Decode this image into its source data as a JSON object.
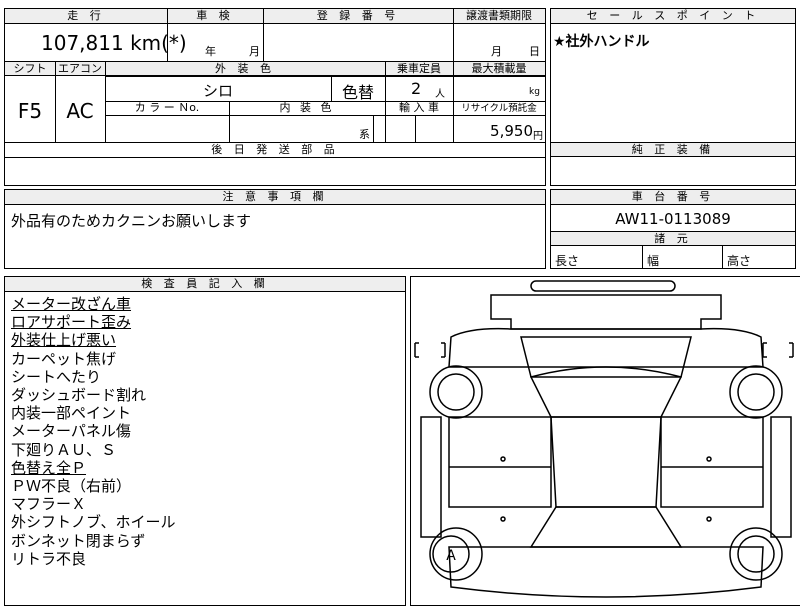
{
  "main_table": {
    "h_mileage": "走 行",
    "h_inspection": "車 検",
    "h_registration": "登 録 番 号",
    "h_transfer_deadline": "譲渡書類期限",
    "mileage": "107,811 km(*)",
    "inspection_year_label": "年",
    "inspection_month_label": "月",
    "transfer_month_label": "月",
    "transfer_day_label": "日",
    "h_shift": "シフト",
    "h_aircon": "エアコン",
    "h_exterior_color": "外 装 色",
    "h_capacity": "乗車定員",
    "h_max_load": "最大積載量",
    "shift": "F5",
    "aircon": "AC",
    "exterior_color": "シロ",
    "color_change": "色替",
    "capacity": "2",
    "capacity_unit": "人",
    "max_load_unit": "kg",
    "h_color_no": "カ ラ ー Ｎo.",
    "h_interior_color": "内 装 色",
    "h_import": "輸 入 車",
    "h_recycle": "リサイクル預託金",
    "interior_color_unit": "系",
    "recycle_fee": "5,950",
    "recycle_unit": "円",
    "h_later_parts": "後 日 発 送 部 品"
  },
  "sales_points": {
    "header": "セ ー ル ス ポ イ ン ト",
    "text": "★社外ハンドル",
    "genuine_header": "純 正 装 備"
  },
  "notes": {
    "header": "注 意 事 項 欄",
    "text": "外品有のためカクニンお願いします"
  },
  "chassis": {
    "header": "車 台 番 号",
    "number": "AW11-0113089",
    "spec_header": "諸 元",
    "length_label": "長さ",
    "width_label": "幅",
    "height_label": "高さ"
  },
  "inspector": {
    "header": "検 査 員 記 入 欄",
    "lines": [
      {
        "text": "メーター改ざん車",
        "underline": true
      },
      {
        "text": "ロアサポート歪み",
        "underline": true
      },
      {
        "text": "外装仕上げ悪い",
        "underline": true
      },
      {
        "text": "カーペット焦げ",
        "underline": false
      },
      {
        "text": "シートへたり",
        "underline": false
      },
      {
        "text": "ダッシュボード割れ",
        "underline": false
      },
      {
        "text": "内装一部ペイント",
        "underline": false
      },
      {
        "text": "メーターパネル傷",
        "underline": false
      },
      {
        "text": "下廻りＡＵ、Ｓ",
        "underline": false
      },
      {
        "text": "色替え全Ｐ",
        "underline": true
      },
      {
        "text": "ＰＷ不良（右前）",
        "underline": false
      },
      {
        "text": "マフラーＸ",
        "underline": false
      },
      {
        "text": "外シフトノブ、ホイール",
        "underline": false
      },
      {
        "text": "ボンネット閉まらず",
        "underline": false
      },
      {
        "text": "リトラ不良",
        "underline": false
      }
    ]
  },
  "diagram": {
    "tire_mark": "A"
  }
}
